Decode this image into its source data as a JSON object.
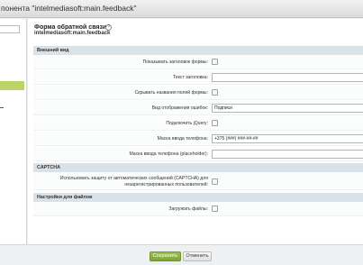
{
  "window": {
    "title": "понента \"intelmediasoft:main.feedback\""
  },
  "form": {
    "title": "Форма обратной связи",
    "subtitle": "intelmediasoft:main.feedback",
    "help_icon": "?"
  },
  "sections": {
    "appearance": "Внешний вид",
    "captcha": "CAPTCHA",
    "files": "Настройки для файлов"
  },
  "fields": {
    "show_form_title": {
      "label": "Показывать заголовок формы:",
      "checked": false
    },
    "title_text": {
      "label": "Текст заголовка:",
      "value": ""
    },
    "hide_field_names": {
      "label": "Скрывать названия полей формы:",
      "checked": false
    },
    "error_view": {
      "label": "Вид отображения ошибок:",
      "value": "Подписи"
    },
    "connect_jquery": {
      "label": "Подключить jQuery:",
      "checked": false
    },
    "phone_mask": {
      "label": "Маска ввода телефона:",
      "value": "+375 (###) ###-##-##"
    },
    "phone_placeholder": {
      "label": "Маска ввода телефона (placeholder):",
      "value": ""
    },
    "use_captcha": {
      "label_line1": "Использовать защиту от автоматических сообщений (CAPTCHA) для",
      "label_line2": "незарегистрированных пользователей:",
      "checked": false
    },
    "upload_files": {
      "label": "Загружать файлы:",
      "checked": false
    }
  },
  "footer": {
    "save_label": "Сохранить",
    "cancel_label": "Отменить"
  },
  "colors": {
    "accent": "#8ab33f",
    "section_bg": "#dbe2e7",
    "sidebar_selected": "#bcd36a"
  }
}
